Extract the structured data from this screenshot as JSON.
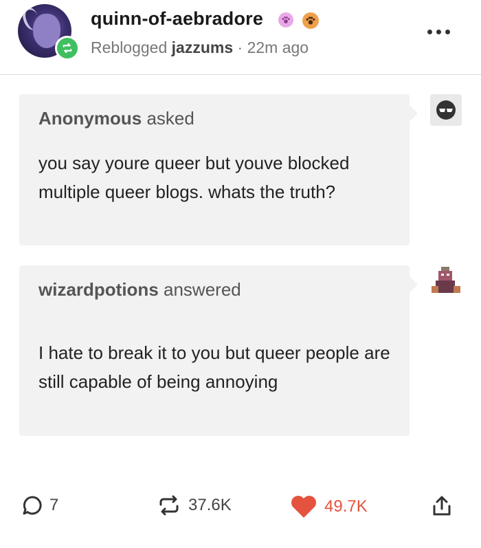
{
  "post": {
    "author": "quinn-of-aebradore",
    "reblog_prefix": "Reblogged",
    "reblogged_from": "jazzums",
    "separator": "·",
    "time_ago": "22m ago"
  },
  "ask": {
    "asker": "Anonymous",
    "verb": "asked",
    "question": "you say youre queer but youve blocked multiple queer blogs. whats the truth?"
  },
  "answer": {
    "answerer": "wizardpotions",
    "verb": "answered",
    "text": "I hate to break it to you but queer people are still capable of being annoying"
  },
  "footer": {
    "comments": "7",
    "reblogs": "37.6K",
    "likes": "49.7K"
  },
  "colors": {
    "reblog_green": "#3fbf5f",
    "like_red": "#e4533e",
    "bubble_bg": "#f2f2f2"
  },
  "icons": [
    "reblog-icon",
    "badge-paw-pink-icon",
    "badge-paw-orange-icon",
    "more-options-icon",
    "comment-icon",
    "reblog-count-icon",
    "heart-icon",
    "share-icon"
  ]
}
